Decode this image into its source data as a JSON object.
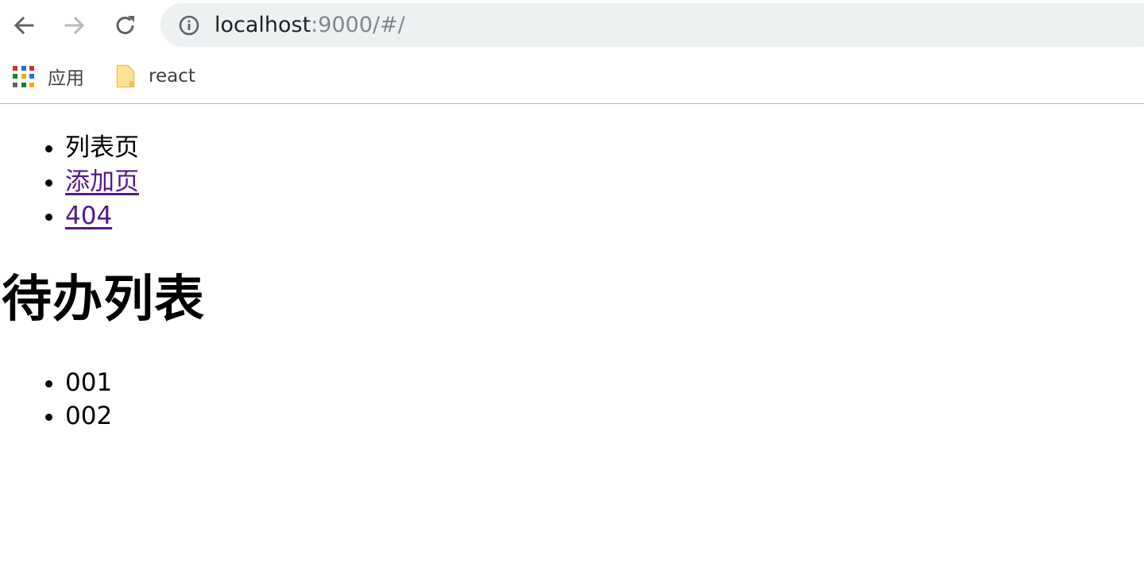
{
  "browser": {
    "url_host": "localhost",
    "url_rest": ":9000/#/",
    "icons": {
      "back": "back-arrow-icon",
      "forward": "forward-arrow-icon",
      "reload": "reload-icon",
      "site_info": "info-icon"
    },
    "bookmarks": [
      {
        "label": "应用",
        "icon": "apps-grid-icon"
      },
      {
        "label": "react",
        "icon": "folder-icon"
      }
    ]
  },
  "nav": {
    "items": [
      {
        "label": "列表页",
        "is_link": false
      },
      {
        "label": "添加页",
        "is_link": true
      },
      {
        "label": "404",
        "is_link": true
      }
    ]
  },
  "main": {
    "title": "待办列表",
    "todos": [
      "001",
      "002"
    ]
  },
  "colors": {
    "visited_link": "#551a8b",
    "omnibox_bg": "#eef1f2",
    "text": "#000000"
  }
}
